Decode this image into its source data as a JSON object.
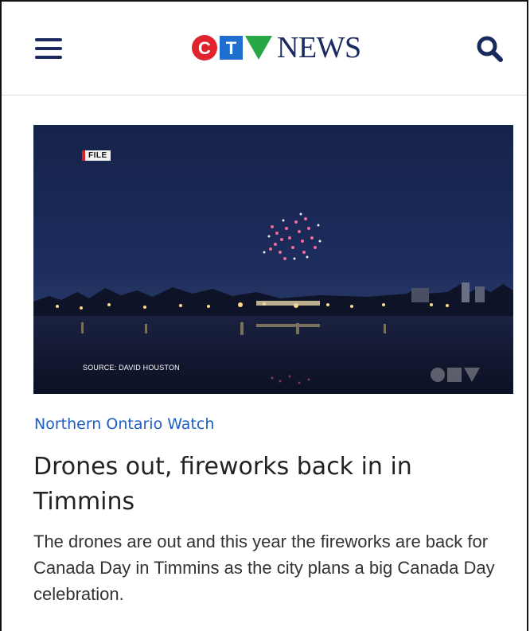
{
  "header": {
    "menu_icon": "hamburger-menu-icon",
    "search_icon": "search-icon",
    "logo": {
      "letters": [
        "C",
        "T",
        "V"
      ],
      "text": "NEWS"
    },
    "colors": {
      "navy": "#1b2a5e",
      "red": "#e1232e",
      "blue": "#1f6fd1",
      "green": "#27a844"
    }
  },
  "article": {
    "image": {
      "badge": "FILE",
      "source": "SOURCE: DAVID HOUSTON",
      "watermark": "CTV"
    },
    "category": "Northern Ontario Watch",
    "headline": "Drones out, fireworks back in in Timmins",
    "summary": "The drones are out and this year the fireworks are back for Canada Day in Timmins as the city plans a big Canada Day celebration."
  }
}
